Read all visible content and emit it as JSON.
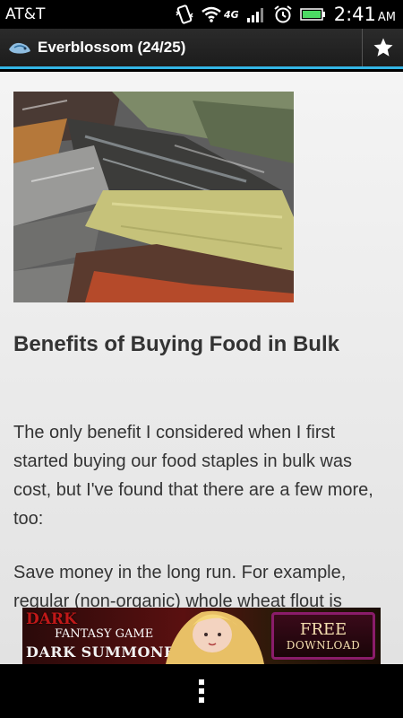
{
  "status_bar": {
    "carrier": "AT&T",
    "network": "4G",
    "time": "2:41",
    "ampm": "AM",
    "icons": [
      "vibrate-icon",
      "wifi-icon",
      "signal-icon",
      "alarm-icon",
      "battery-icon"
    ]
  },
  "action_bar": {
    "title": "Everblossom (24/25)",
    "app_icon": "app-logo-icon",
    "action_icon": "star-icon"
  },
  "article": {
    "title": "Benefits of Buying Food in Bulk",
    "paragraphs": [
      "The only benefit I considered when I first started buying our food staples in bulk was cost, but I've found that there are a few more, too:",
      "Save money in the long run. For example, regular (non-organic) whole wheat flout is"
    ]
  },
  "ad": {
    "line1": "DARK",
    "line2": "FANTASY GAME",
    "line3": "DARK SUMMONER",
    "cta_line1": "FREE",
    "cta_line2": "DOWNLOAD"
  },
  "nav_bar": {
    "menu_icon": "overflow-menu-icon"
  },
  "colors": {
    "accent": "#33b5e5",
    "action_bar": "#222222",
    "text": "#333333"
  }
}
